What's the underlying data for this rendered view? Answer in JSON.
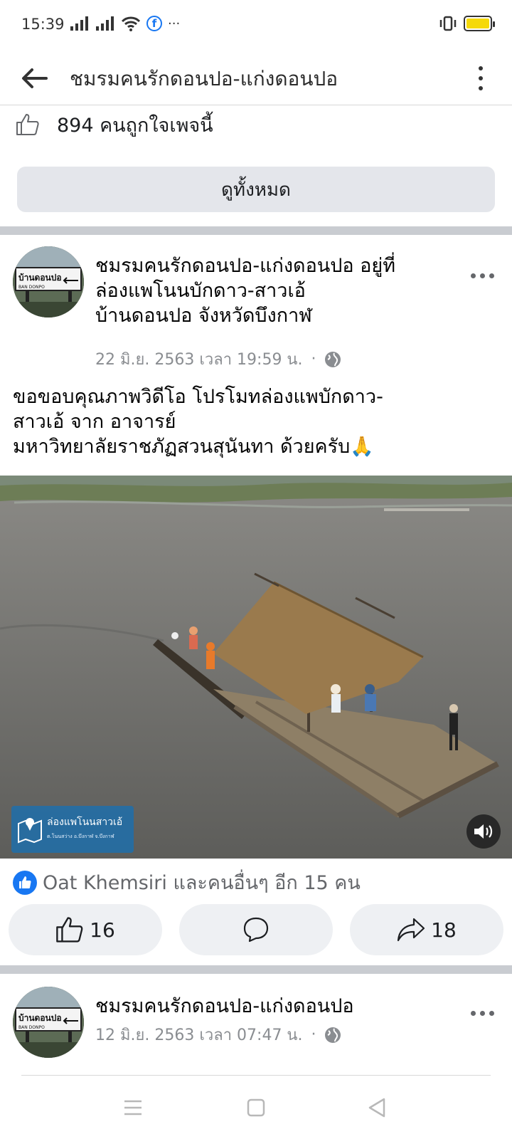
{
  "status_bar": {
    "time": "15:39",
    "more": "···",
    "facebook_glyph": "f"
  },
  "app_bar": {
    "title": "ชมรมคนรักดอนปอ-แก่งดอนปอ"
  },
  "page_likes": {
    "text": "894 คนถูกใจเพจนี้"
  },
  "see_all": {
    "label": "ดูทั้งหมด"
  },
  "post1": {
    "avatar_sign": "บ้านดอนปอ",
    "avatar_sign_en": "BAN DONPO",
    "author_lines": [
      "ชมรมคนรักดอนปอ-แก่งดอนปอ อยู่ที่",
      "ล่องแพโนนบักดาว-สาวเอ้",
      "บ้านดอนปอ จังหวัดบึงกาฬ"
    ],
    "timestamp": "22 มิ.ย. 2563 เวลา 19:59 น.",
    "separator": "·",
    "text_lines": [
      "ขอขอบคุณภาพวิดีโอ โปรโมทล่องแพบักดาว-",
      "สาวเอ้ จาก อาจารย์",
      "มหาวิทยาลัยราชภัฏสวนสุนันทา ด้วยครับ🙏"
    ],
    "video_badge_title": "ล่องแพโนนสาวเอ้",
    "video_badge_sub": "ต.โนนสว่าง อ.บึงกาฬ จ.บึงกาฬ",
    "reactions_text": "Oat Khemsiri และคนอื่นๆ อีก 15 คน",
    "like_count": "16",
    "share_count": "18"
  },
  "post2": {
    "avatar_sign": "บ้านดอนปอ",
    "avatar_sign_en": "BAN DONPO",
    "author": "ชมรมคนรักดอนปอ-แก่งดอนปอ",
    "timestamp": "12 มิ.ย. 2563 เวลา 07:47 น.",
    "separator": "·"
  },
  "icons": [
    "signal-icon",
    "wifi-icon",
    "facebook-icon",
    "vibrate-icon",
    "battery-icon",
    "back-arrow-icon",
    "more-vert-icon",
    "thumbs-up-icon",
    "globe-icon",
    "more-horiz-icon",
    "sound-icon",
    "comment-icon",
    "share-icon",
    "menu-icon",
    "home-icon",
    "back-nav-icon"
  ],
  "colors": {
    "accent": "#1877f2",
    "divider": "#c9ccd1",
    "button_bg": "#e4e6eb",
    "battery": "#f5d90a"
  }
}
